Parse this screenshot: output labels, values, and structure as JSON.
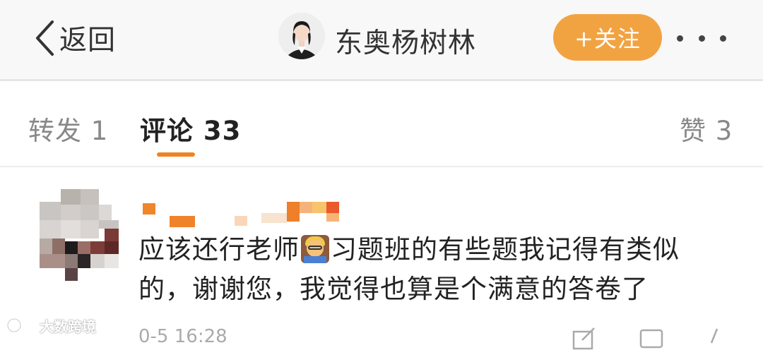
{
  "header": {
    "back_label": "返回",
    "title": "东奥杨树林",
    "follow_label": "+关注"
  },
  "tabs": [
    {
      "label": "转发 1"
    },
    {
      "label": "评论 33"
    },
    {
      "label": "赞 3"
    }
  ],
  "comment": {
    "text_part1": "应该还行老师",
    "text_part2": "习题班的有些题我记得有类似的，谢谢您，我觉得也算是个满意的答卷了",
    "time_partial": "0-5 16:28",
    "emoji": "teacher-emoji"
  },
  "watermark": {
    "label": "大数跨境"
  },
  "colors": {
    "accent": "#f08322",
    "follow_bg": "#f2a341",
    "header_bg": "#f8f8f8"
  }
}
